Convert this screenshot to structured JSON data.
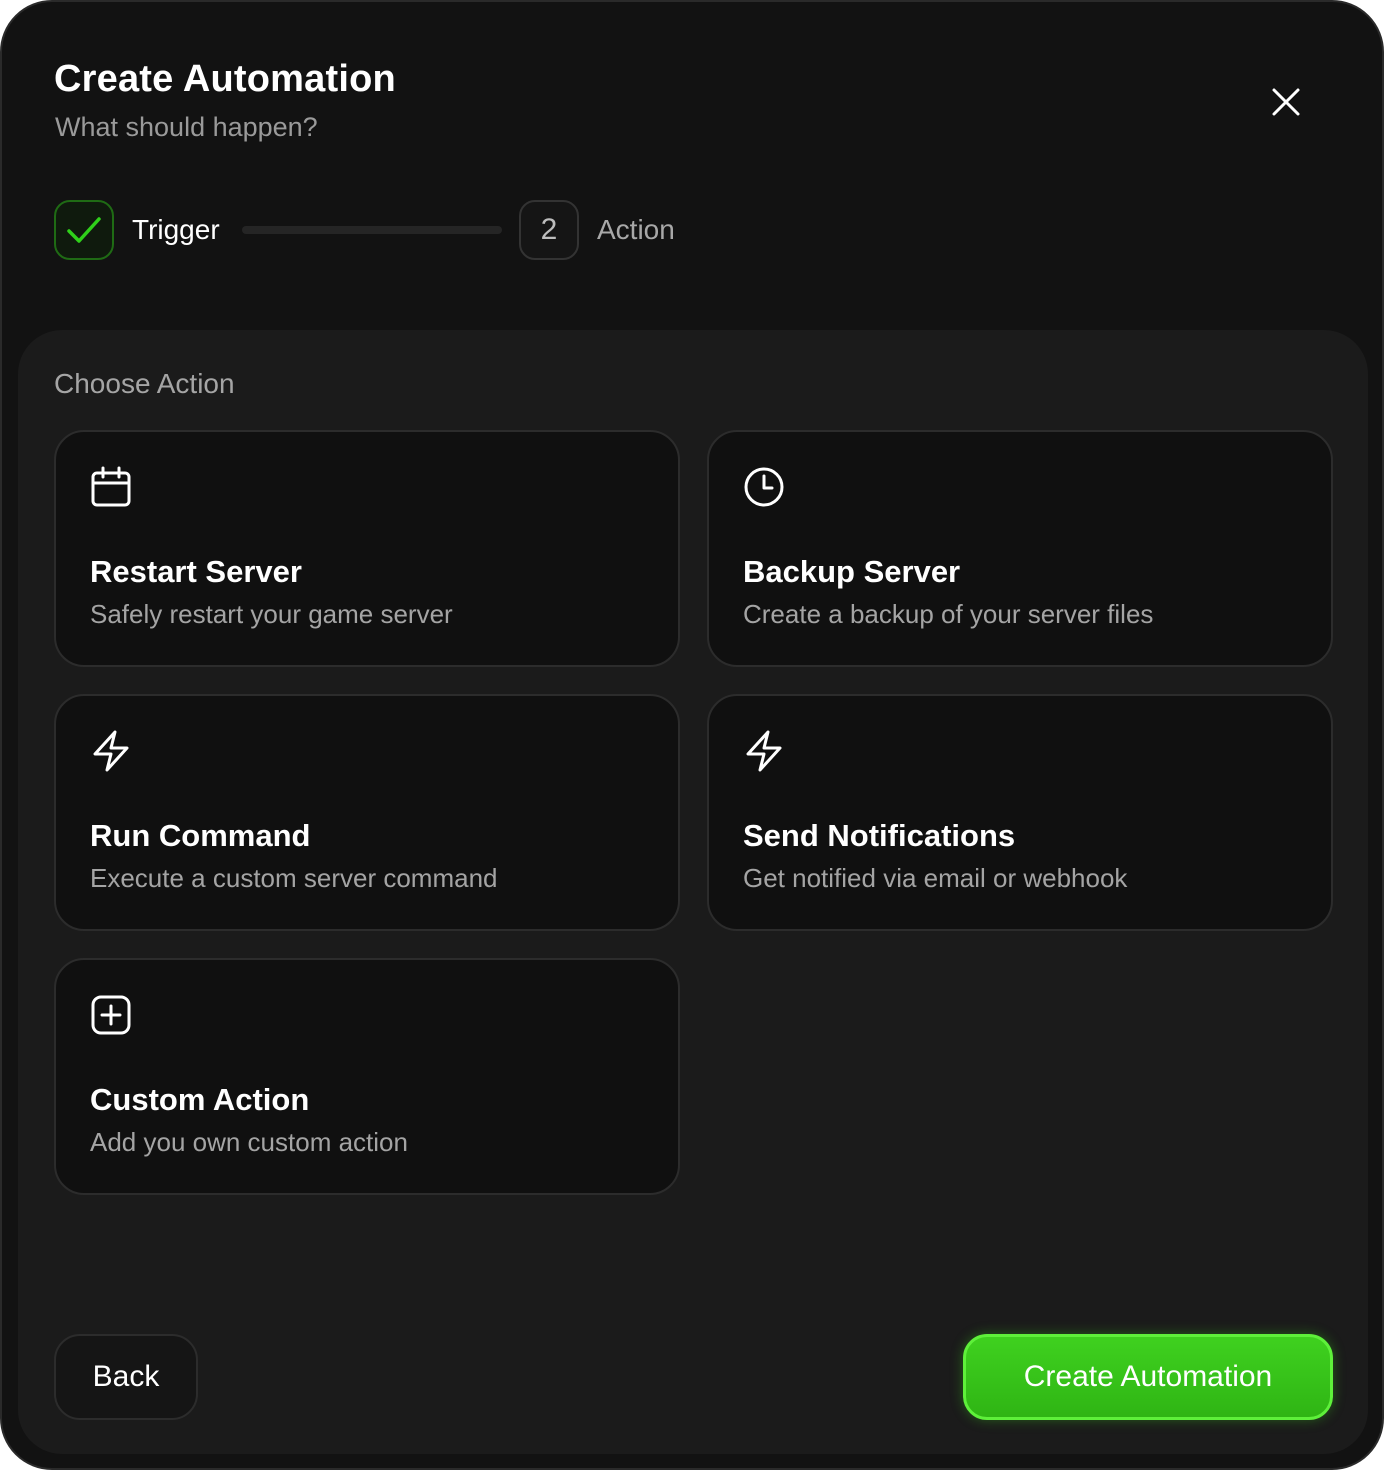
{
  "header": {
    "title": "Create Automation",
    "subtitle": "What should happen?",
    "close_icon": "close-icon"
  },
  "stepper": {
    "steps": [
      {
        "label": "Trigger",
        "state": "completed",
        "icon": "check-icon"
      },
      {
        "label": "Action",
        "number": "2",
        "state": "pending"
      }
    ]
  },
  "section": {
    "label": "Choose Action"
  },
  "actions": [
    {
      "title": "Restart Server",
      "description": "Safely restart your game server",
      "icon": "calendar-icon"
    },
    {
      "title": "Backup Server",
      "description": "Create a backup of your server files",
      "icon": "clock-icon"
    },
    {
      "title": "Run Command",
      "description": "Execute a custom server command",
      "icon": "lightning-icon"
    },
    {
      "title": "Send Notifications",
      "description": "Get notified via email or webhook",
      "icon": "lightning-icon"
    },
    {
      "title": "Custom Action",
      "description": "Add you own custom action",
      "icon": "plus-square-icon"
    }
  ],
  "footer": {
    "back_label": "Back",
    "create_label": "Create Automation"
  },
  "colors": {
    "accent": "#34c018",
    "background": "#121212",
    "panel": "#1b1b1b",
    "card": "#101010"
  }
}
